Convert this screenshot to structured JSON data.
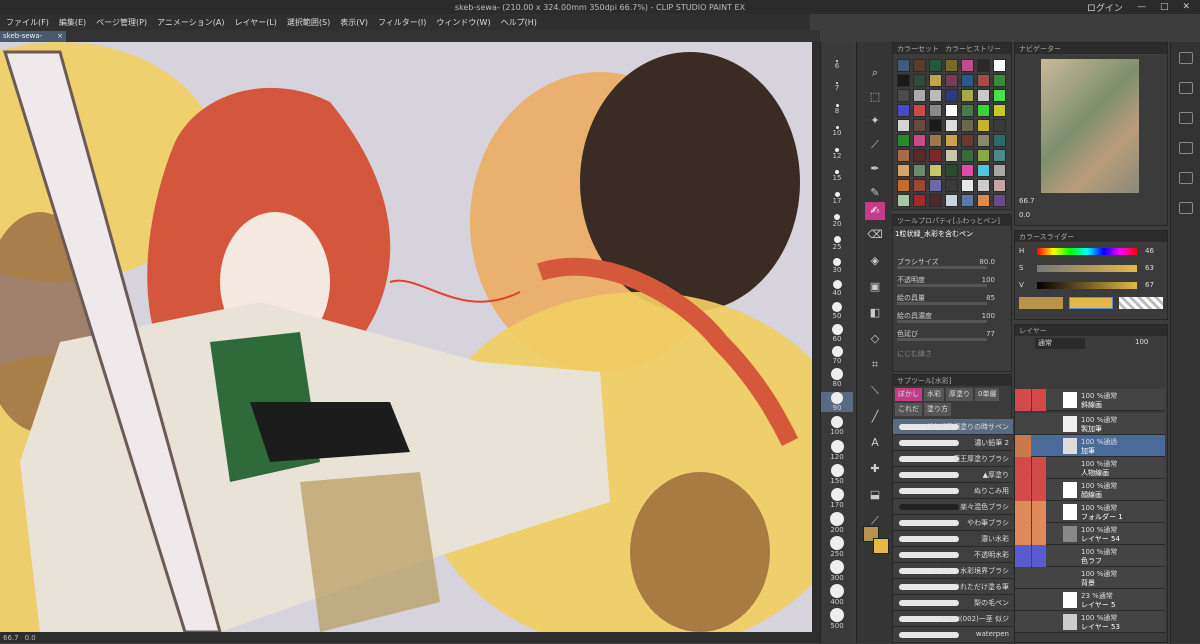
{
  "window": {
    "title": "skeb-sewa-           (210.00 x 324.00mm 350dpi 66.7%) - CLIP STUDIO PAINT EX",
    "controls": [
      "ログイン",
      "—",
      "□",
      "✕"
    ]
  },
  "menu": [
    "ファイル(F)",
    "編集(E)",
    "ページ管理(P)",
    "アニメーション(A)",
    "レイヤー(L)",
    "選択範囲(S)",
    "表示(V)",
    "フィルター(I)",
    "ウィンドウ(W)",
    "ヘルプ(H)"
  ],
  "doc_tab": {
    "label": "skeb-sewa-",
    "close": "×"
  },
  "status": {
    "zoom": "66.7",
    "mid": "0.0"
  },
  "brush_sizes": [
    "6",
    "7",
    "8",
    "10",
    "12",
    "15",
    "17",
    "20",
    "25",
    "30",
    "40",
    "50",
    "60",
    "70",
    "80",
    "90",
    "100",
    "120",
    "150",
    "170",
    "200",
    "250",
    "300",
    "400",
    "500"
  ],
  "palette_tabs": [
    "カラーセット",
    "カラーヒストリー"
  ],
  "navigator": {
    "title": "ナビゲーター",
    "zoom": "66.7",
    "angle": "0.0"
  },
  "color_slider": {
    "title": "カラースライダー",
    "h": "46",
    "s": "63",
    "v": "67",
    "labels": [
      "H",
      "S",
      "V"
    ]
  },
  "tool_property": {
    "title": "ツールプロパティ[ふわっとペン]",
    "preset": "1粒状緑_水彩を含むペン",
    "rows": [
      {
        "label": "ブラシサイズ",
        "value": "80.0"
      },
      {
        "label": "不透明度",
        "value": "100"
      },
      {
        "label": "絵の具量",
        "value": "85"
      },
      {
        "label": "絵の具濃度",
        "value": "100"
      },
      {
        "label": "色延び",
        "value": "77"
      }
    ],
    "extra": "にじむ縁さ"
  },
  "subtool": {
    "title": "サブツール[水彩]",
    "tabs": [
      "ぼかし",
      "水彩",
      "厚塗り",
      "0単層",
      "これだ",
      "塗り方"
    ],
    "brushes": [
      "(削)部屋調塗りの時サペン",
      "濃い鉛筆 2",
      "廃王厚塗りブラシ",
      "▲厚塗り",
      "ぬりこみ用",
      "楽々混色ブラシ",
      "やわ筆ブラシ",
      "濃い水彩",
      "不透明水彩",
      "ジェル・水彩境界ブラシ",
      "されただけ塗る筆",
      "梨の毛ペン",
      "LENEN(002)一茎 似ジ",
      "waterpen"
    ]
  },
  "layers": {
    "title": "レイヤー",
    "blend": "通常",
    "opacity": "100",
    "items": [
      {
        "mode": "100 %通常",
        "name": "レイヤー 1"
      },
      {
        "mode": "100 %通常",
        "name": "斜線画"
      },
      {
        "mode": "100 %通常",
        "name": "製加筆"
      },
      {
        "mode": "100 %通過",
        "name": "加筆"
      },
      {
        "mode": "100 %通常",
        "name": "人物線画"
      },
      {
        "mode": "100 %通常",
        "name": "顔線画"
      },
      {
        "mode": "100 %通常",
        "name": "フォルダー 1"
      },
      {
        "mode": "100 %通常",
        "name": "レイヤー 54"
      },
      {
        "mode": "100 %通常",
        "name": "色ラフ"
      },
      {
        "mode": "100 %通常",
        "name": "背景"
      },
      {
        "mode": "23 %通常",
        "name": "レイヤー 5"
      },
      {
        "mode": "100 %通常",
        "name": "レイヤー 53"
      }
    ]
  },
  "colors": {
    "accent": "#5a8dd6",
    "palette": [
      "#3f5a7a",
      "#5b3a2a",
      "#1f5a3a",
      "#7a6a2a",
      "#c24a8a",
      "#2a2a2a",
      "#ffffff",
      "#1a1a1a",
      "#2d4a3a",
      "#c2a44a",
      "#7a3a5a",
      "#2a5a8a",
      "#a84a4a",
      "#3a8a3a",
      "#4a4a4a",
      "#aaaaaa",
      "#bbbbbb",
      "#2a3a7a",
      "#a8a84a",
      "#c8c8c8",
      "#4ae04a",
      "#4a4ac8",
      "#c84a4a",
      "#8a8a8a",
      "#ffffff",
      "#4a7a4a",
      "#3ad23a",
      "#c8c82a",
      "#d4d4d4",
      "#6a4a3a",
      "#1a1a1a",
      "#dddddd",
      "#6a6a4a",
      "#c8b42a",
      "#3a3a3a",
      "#2a8a2a",
      "#c84a8a",
      "#9a7a4a",
      "#c8a44a",
      "#6a3a2a",
      "#8a8a6a",
      "#2a6a6a",
      "#a86a4a",
      "#5a2a2a",
      "#7a2a2a",
      "#c8c8a8",
      "#3a6a3a",
      "#8aa84a",
      "#4a8a8a",
      "#d4a46a",
      "#6a8a6a",
      "#c8c86a",
      "#2a4a2a",
      "#e04aa8",
      "#4ac8e0",
      "#a8a8a8",
      "#c86a2a",
      "#9a4a2a",
      "#6a6aa8",
      "#3a3a3a",
      "#e8e8e8",
      "#cccccc",
      "#c8a4a4",
      "#a4c8a4",
      "#a42a2a",
      "#4a2a2a",
      "#c8d4e0",
      "#5a7aa8",
      "#e08a4a",
      "#6a4a8a"
    ]
  }
}
